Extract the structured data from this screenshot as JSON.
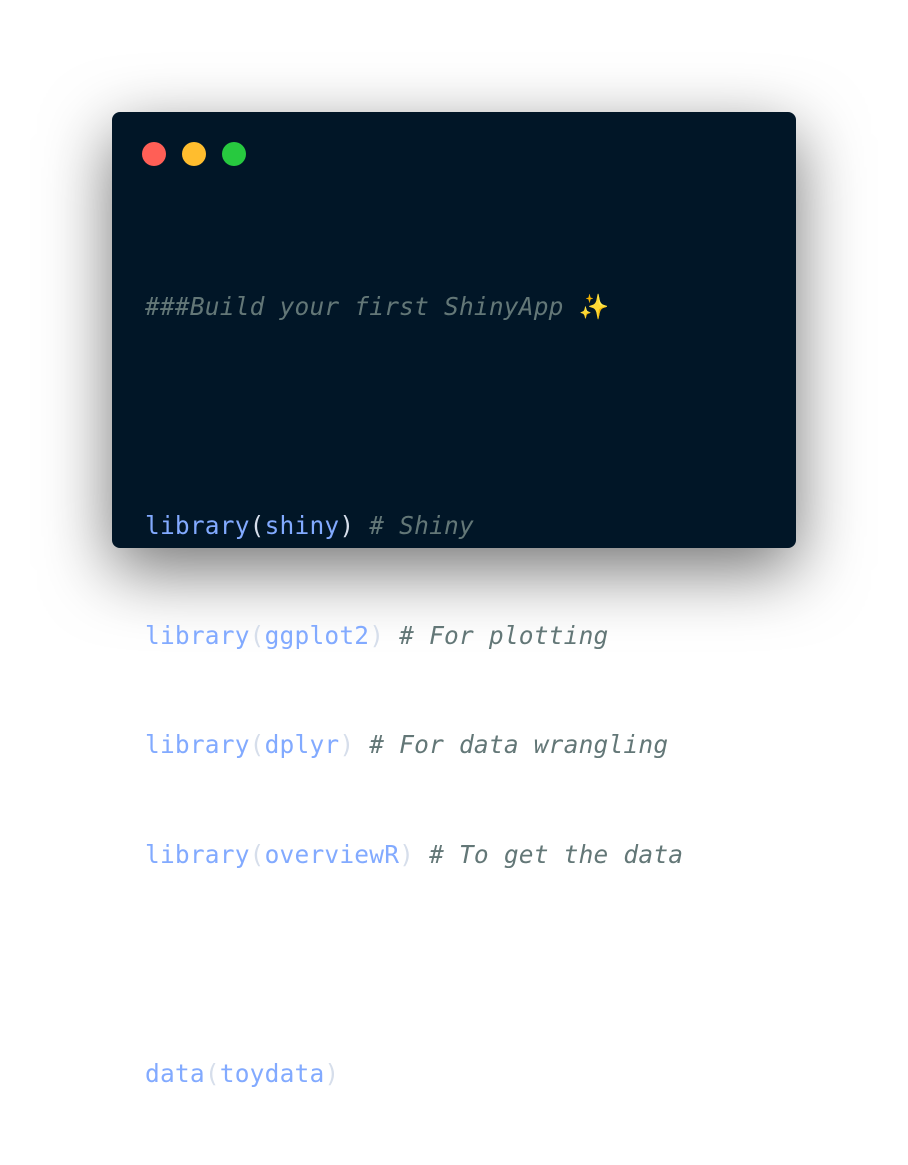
{
  "window_controls": {
    "close_color": "#ff5f56",
    "minimize_color": "#ffbd2e",
    "maximize_color": "#27c93f"
  },
  "code": {
    "header_comment": "###Build your first ShinyApp ",
    "header_emoji": "✨",
    "lines": [
      {
        "fn": "library",
        "open": "(",
        "arg": "shiny",
        "close": ")",
        "comment": " # Shiny"
      },
      {
        "fn": "library",
        "open": "(",
        "arg": "ggplot2",
        "close": ")",
        "comment": " # For plotting"
      },
      {
        "fn": "library",
        "open": "(",
        "arg": "dplyr",
        "close": ")",
        "comment": " # For data wrangling"
      },
      {
        "fn": "library",
        "open": "(",
        "arg": "overviewR",
        "close": ")",
        "comment": " # To get the data"
      }
    ],
    "data_call": {
      "fn": "data",
      "open": "(",
      "arg": "toydata",
      "close": ")"
    }
  },
  "colors": {
    "background": "#011627",
    "comment": "#637777",
    "function": "#82aaff",
    "punctuation": "#d6deeb"
  }
}
